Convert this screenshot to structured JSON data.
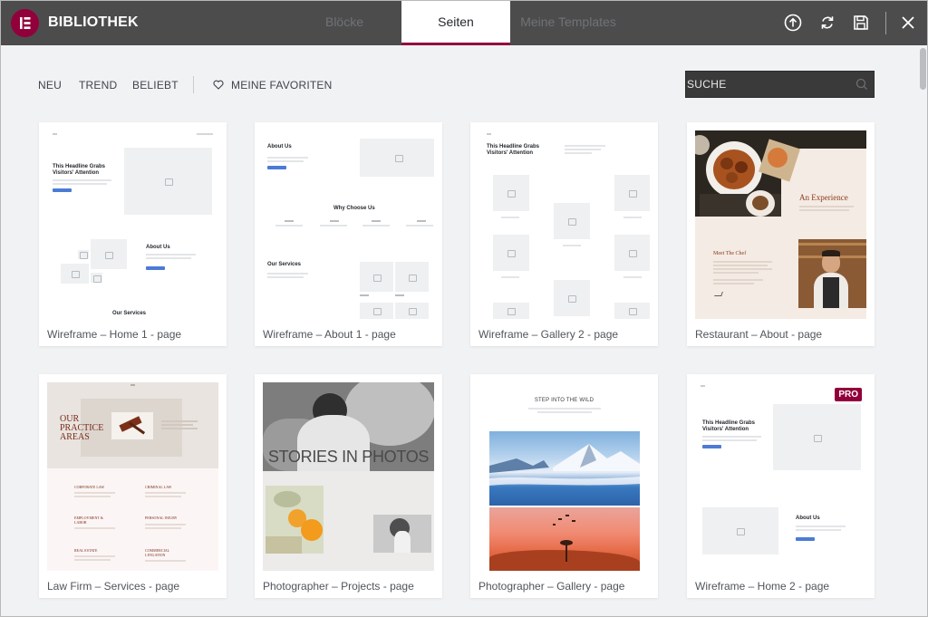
{
  "header": {
    "brand": "BIBLIOTHEK",
    "tabs": [
      {
        "label": "Blöcke",
        "active": false
      },
      {
        "label": "Seiten",
        "active": true
      },
      {
        "label": "Meine Templates",
        "active": false
      }
    ],
    "icons": [
      "upload-icon",
      "sync-icon",
      "save-icon",
      "close-icon"
    ]
  },
  "filters": {
    "items": [
      "NEU",
      "TREND",
      "BELIEBT"
    ],
    "favorites": "MEINE FAVORITEN",
    "search_placeholder": "SUCHE"
  },
  "colors": {
    "brand": "#92003b",
    "header_bg": "#4c4c4c",
    "panel_bg": "#f1f2f4",
    "wire_button": "#4b7bd6"
  },
  "cards": [
    {
      "title": "Wireframe – Home 1 - page",
      "pro": false,
      "thumb": {
        "headline": "This Headline Grabs Visitors' Attention",
        "about": "About Us",
        "services": "Our Services"
      }
    },
    {
      "title": "Wireframe – About 1 - page",
      "pro": false,
      "thumb": {
        "about": "About Us",
        "why": "Why Choose Us",
        "services": "Our Services"
      }
    },
    {
      "title": "Wireframe – Gallery 2 - page",
      "pro": false,
      "thumb": {
        "headline": "This Headline Grabs Visitors' Attention"
      }
    },
    {
      "title": "Restaurant – About - page",
      "pro": false,
      "thumb": {
        "experience": "An Experience",
        "chef": "Meet The Chef"
      }
    },
    {
      "title": "Law Firm – Services - page",
      "pro": false,
      "thumb": {
        "headline": "OUR PRACTICE AREAS",
        "areas": [
          "CORPORATE LAW",
          "CRIMINAL LAW",
          "EMPLOYMENT & LABOR",
          "PERSONAL INJURY",
          "REAL ESTATE",
          "COMMERCIAL LITIGATION"
        ]
      }
    },
    {
      "title": "Photographer – Projects - page",
      "pro": false,
      "thumb": {
        "headline": "STORIES IN PHOTOS"
      }
    },
    {
      "title": "Photographer – Gallery - page",
      "pro": false,
      "thumb": {
        "headline": "STEP INTO THE WILD"
      }
    },
    {
      "title": "Wireframe – Home 2 - page",
      "pro": true,
      "pro_label": "PRO",
      "thumb": {
        "headline": "This Headline Grabs Visitors' Attention",
        "about": "About Us"
      }
    }
  ]
}
